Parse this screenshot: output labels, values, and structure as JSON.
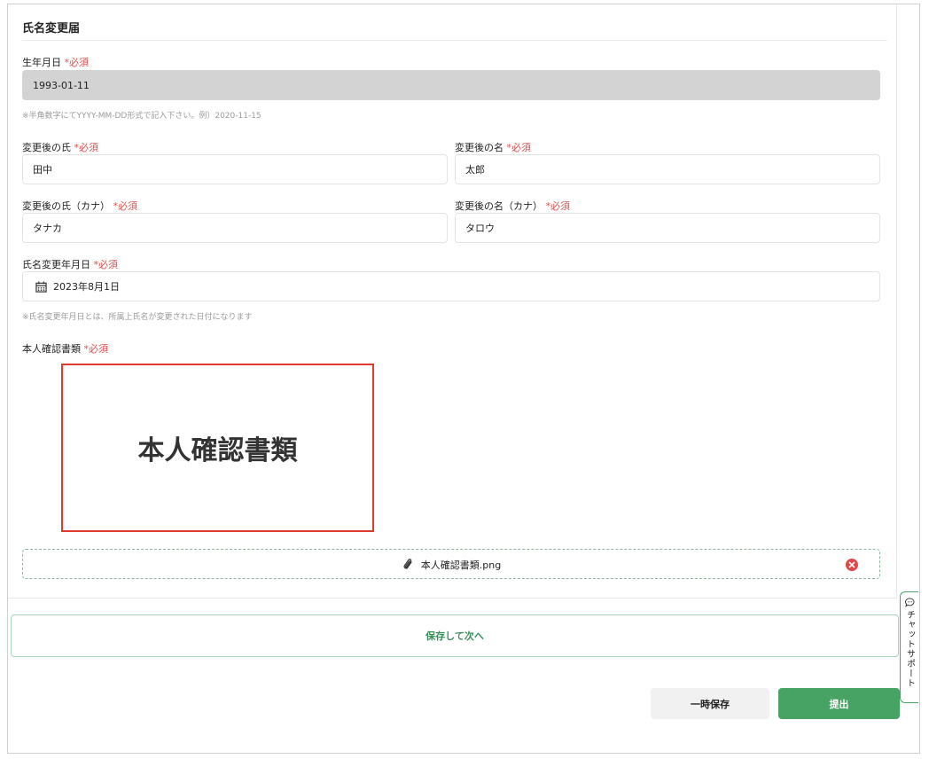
{
  "form": {
    "title": "氏名変更届",
    "required_mark": "*必須",
    "birthdate": {
      "label": "生年月日",
      "value": "1993-01-11",
      "hint": "※半角数字にてYYYY-MM-DD形式で記入下さい。例）2020-11-15"
    },
    "last_name": {
      "label": "変更後の氏",
      "value": "田中"
    },
    "first_name": {
      "label": "変更後の名",
      "value": "太郎"
    },
    "last_name_kana": {
      "label": "変更後の氏（カナ）",
      "value": "タナカ"
    },
    "first_name_kana": {
      "label": "変更後の名（カナ）",
      "value": "タロウ"
    },
    "change_date": {
      "label": "氏名変更年月日",
      "value": "2023年8月1日",
      "hint": "※氏名変更年月日とは、所属上氏名が変更された日付になります",
      "icon": "calendar-icon"
    },
    "id_document": {
      "label": "本人確認書類",
      "preview_text": "本人確認書類",
      "file_name": "本人確認書類.png",
      "attach_icon": "paperclip-icon",
      "remove_icon": "remove-icon"
    }
  },
  "actions": {
    "save_next": "保存して次へ",
    "temp_save": "一時保存",
    "submit": "提出"
  },
  "chat_support": {
    "label": "チャットサポート",
    "icon": "chat-bubble-icon"
  },
  "colors": {
    "required": "#d9534f",
    "primary_green": "#46a364",
    "preview_border": "#e03a2f",
    "remove_red": "#e04848"
  }
}
